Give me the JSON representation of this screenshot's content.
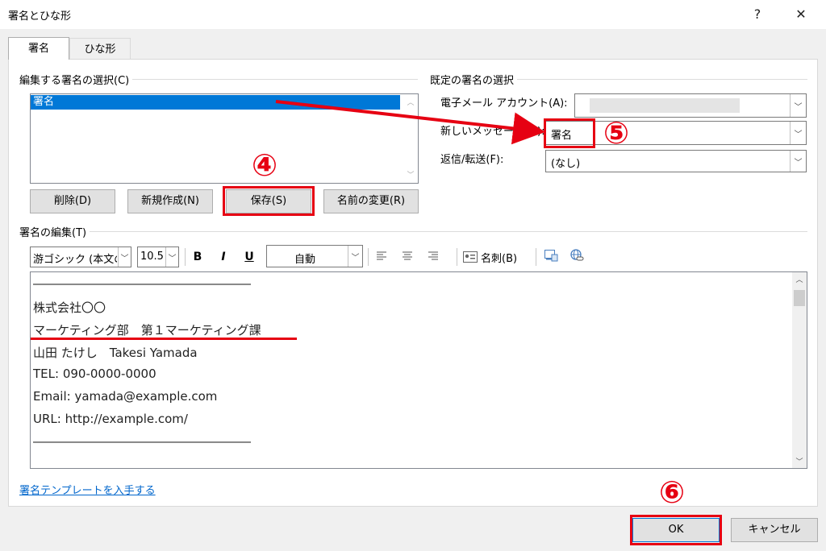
{
  "window": {
    "title": "署名とひな形",
    "help_label": "?",
    "close_label": "✕"
  },
  "tabs": [
    {
      "label": "署名"
    },
    {
      "label": "ひな形"
    }
  ],
  "select_group": {
    "label": "編集する署名の選択(C)",
    "items": [
      "署名"
    ],
    "buttons": {
      "delete": "削除(D)",
      "new": "新規作成(N)",
      "save": "保存(S)",
      "rename": "名前の変更(R)"
    }
  },
  "default_group": {
    "label": "既定の署名の選択",
    "account_label": "電子メール アカウント(A):",
    "account_value": "",
    "new_message_label": "新しいメッセージ(M):",
    "new_message_value": "署名",
    "reply_label": "返信/転送(F):",
    "reply_value": "(なし)"
  },
  "edit_group": {
    "label": "署名の編集(T)",
    "font_name": "游ゴシック (本文の",
    "font_size": "10.5",
    "bold_label": "B",
    "italic_label": "I",
    "underline_label": "U",
    "color_value": "自動",
    "business_card_label": "名刺(B)"
  },
  "signature_lines": [
    "――――――――――――――――――",
    "株式会社〇〇",
    "マーケティング部　第１マーケティング課",
    "山田 たけし　Takesi Yamada",
    "TEL: 090-0000-0000",
    "Email: yamada@example.com",
    "URL: http://example.com/",
    "――――――――――――――――――"
  ],
  "template_link": "署名テンプレートを入手する",
  "footer": {
    "ok_label": "OK",
    "cancel_label": "キャンセル"
  },
  "annotations": {
    "step4": "④",
    "step5": "⑤",
    "step6": "⑥"
  },
  "colors": {
    "accent": "#0078d7",
    "annotation_red": "#e60012"
  }
}
